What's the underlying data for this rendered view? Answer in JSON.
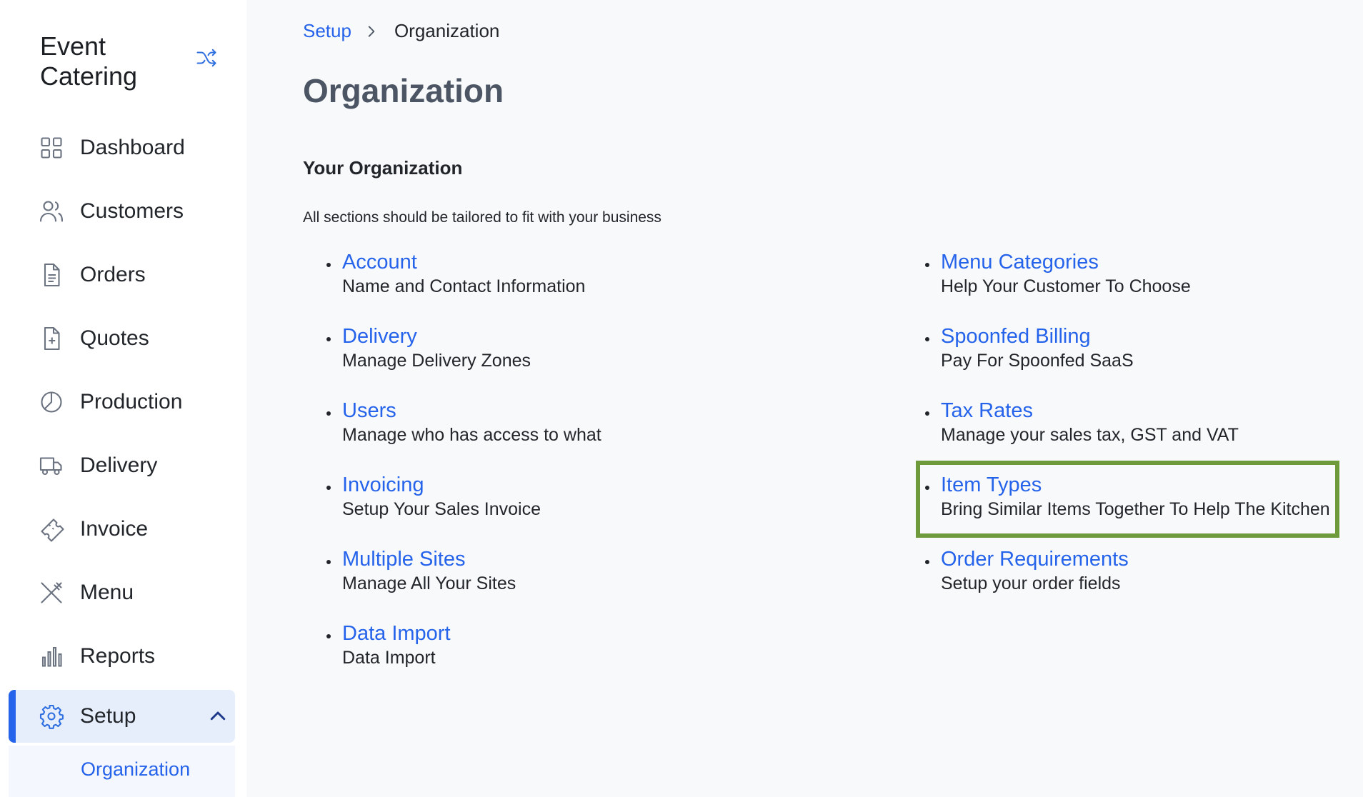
{
  "sidebar": {
    "brand": "Event Catering",
    "brand_switch_icon": "shuffle-icon",
    "items": [
      {
        "label": "Dashboard",
        "icon": "dashboard-icon"
      },
      {
        "label": "Customers",
        "icon": "users-icon"
      },
      {
        "label": "Orders",
        "icon": "document-icon"
      },
      {
        "label": "Quotes",
        "icon": "document-plus-icon"
      },
      {
        "label": "Production",
        "icon": "pie-chart-icon"
      },
      {
        "label": "Delivery",
        "icon": "truck-icon"
      },
      {
        "label": "Invoice",
        "icon": "ticket-icon"
      },
      {
        "label": "Menu",
        "icon": "utensils-icon"
      },
      {
        "label": "Reports",
        "icon": "bar-chart-icon"
      },
      {
        "label": "Setup",
        "icon": "gear-icon",
        "active": true,
        "expanded": true
      }
    ],
    "subitems": [
      {
        "label": "Organization",
        "active": true
      }
    ]
  },
  "breadcrumb": {
    "parent": "Setup",
    "current": "Organization"
  },
  "page": {
    "title": "Organization",
    "section_title": "Your Organization",
    "section_desc": "All sections should be tailored to fit with your business"
  },
  "links": {
    "left": [
      {
        "title": "Account",
        "desc": "Name and Contact Information"
      },
      {
        "title": "Delivery",
        "desc": "Manage Delivery Zones"
      },
      {
        "title": "Users",
        "desc": "Manage who has access to what"
      },
      {
        "title": "Invoicing",
        "desc": "Setup Your Sales Invoice"
      },
      {
        "title": "Multiple Sites",
        "desc": "Manage All Your Sites"
      },
      {
        "title": "Data Import",
        "desc": "Data Import"
      }
    ],
    "right": [
      {
        "title": "Menu Categories",
        "desc": "Help Your Customer To Choose"
      },
      {
        "title": "Spoonfed Billing",
        "desc": "Pay For Spoonfed SaaS"
      },
      {
        "title": "Tax Rates",
        "desc": "Manage your sales tax, GST and VAT"
      },
      {
        "title": "Item Types",
        "desc": "Bring Similar Items Together To Help The Kitchen",
        "highlighted": true
      },
      {
        "title": "Order Requirements",
        "desc": "Setup your order fields"
      }
    ]
  },
  "colors": {
    "accent": "#2563eb",
    "highlight": "#6f9a3c",
    "active_bg": "#e6eefc"
  }
}
